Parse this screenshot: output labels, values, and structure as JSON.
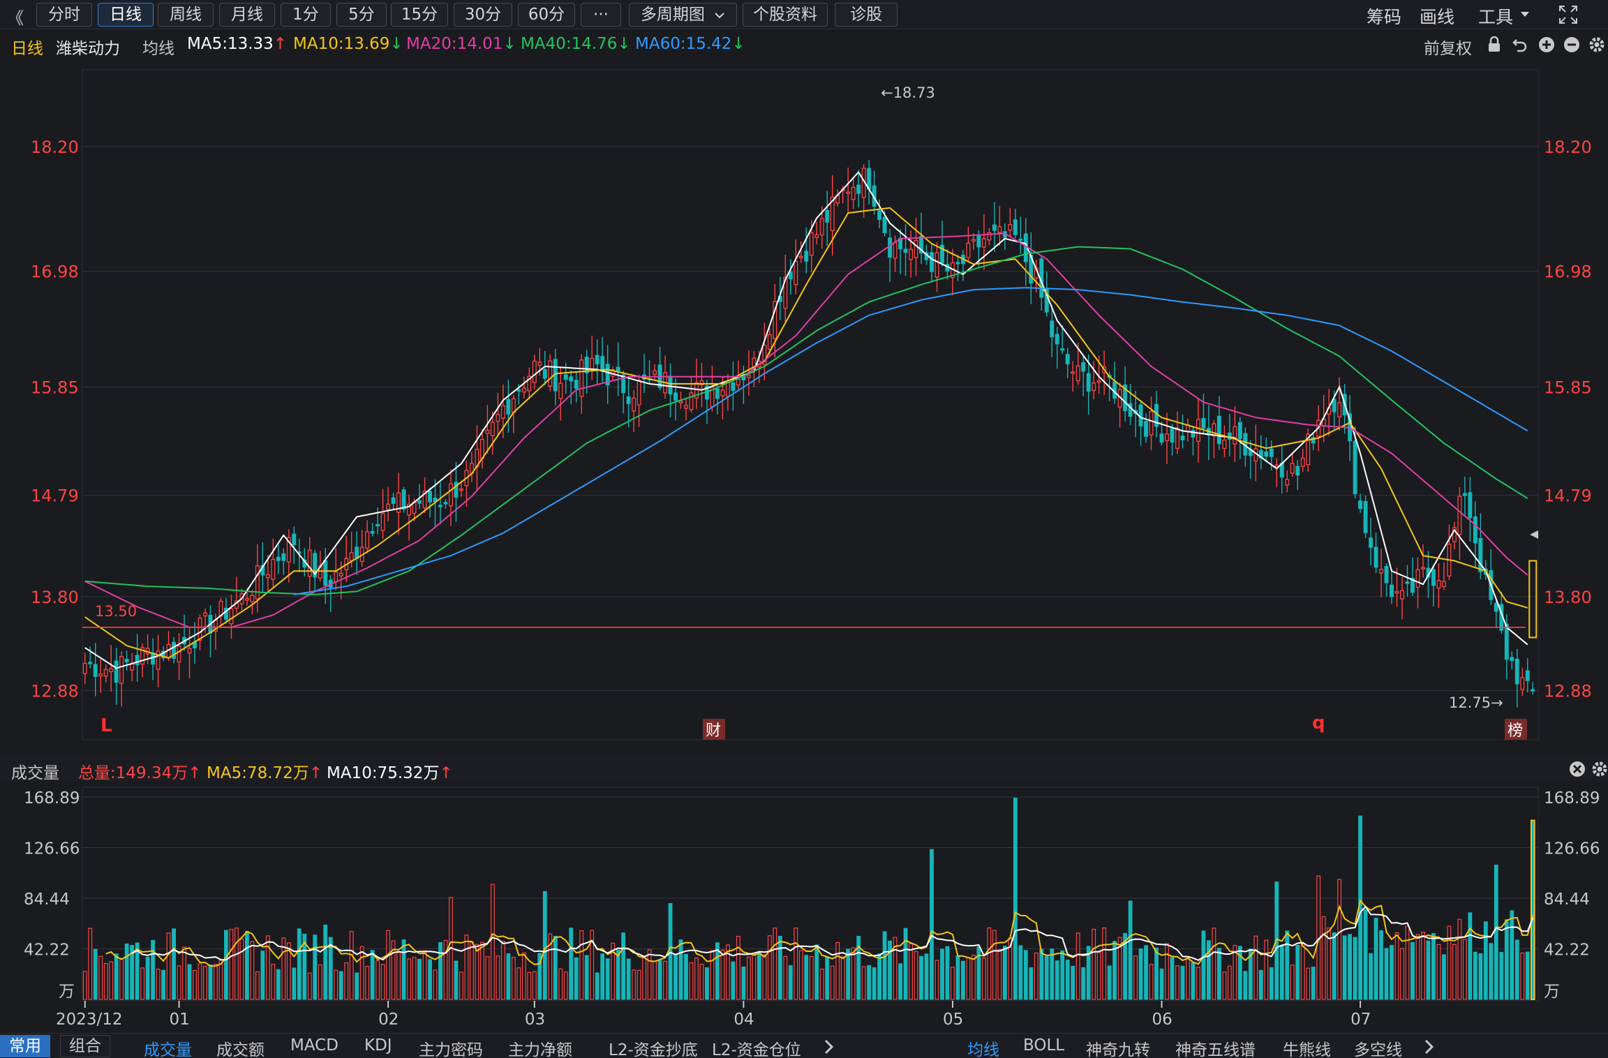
{
  "toolbar": {
    "back_label": "《",
    "periods": [
      "分时",
      "日线",
      "周线",
      "月线",
      "1分",
      "5分",
      "15分",
      "30分",
      "60分",
      "···"
    ],
    "active_period": "日线",
    "multi_label": "多周期图",
    "profile_label": "个股资料",
    "diagnose_label": "诊股",
    "right_items": [
      "筹码",
      "画线",
      "工具"
    ]
  },
  "infobar": {
    "period": "日线",
    "stock_name": "潍柴动力",
    "ma_label": "均线",
    "ma5": "MA5:13.33",
    "ma10": "MA10:13.69",
    "ma20": "MA20:14.01",
    "ma40": "MA40:14.76",
    "ma60": "MA60:15.42",
    "adjust": "前复权"
  },
  "volbar": {
    "title": "成交量",
    "total": "总量:149.34万",
    "ma5": "MA5:78.72万",
    "ma10": "MA10:75.32万"
  },
  "bottombar": {
    "left_tabs": [
      "常用",
      "组合"
    ],
    "indicators": [
      "成交量",
      "成交额",
      "MACD",
      "KDJ",
      "主力密码",
      "主力净额",
      "L2-资金抄底",
      "L2-资金仓位"
    ],
    "overlays": [
      "均线",
      "BOLL",
      "神奇九转",
      "神奇五线谱",
      "牛熊线",
      "多空线"
    ]
  },
  "colors": {
    "up": "#ff4444",
    "down": "#16b5b8",
    "ma5": "#ffffff",
    "ma10": "#f5c518",
    "ma20": "#e23ea8",
    "ma40": "#22c55e",
    "ma60": "#2f9bff",
    "support": "#ff4444"
  },
  "chart_data": [
    {
      "type": "candlestick",
      "title": "潍柴动力 日线",
      "ylim": [
        12.4,
        18.95
      ],
      "y_ticks": [
        "18.20",
        "16.98",
        "15.85",
        "14.79",
        "13.80",
        "12.88"
      ],
      "x_ticks": [
        "2023/12",
        "01",
        "02",
        "03",
        "04",
        "05",
        "06",
        "07"
      ],
      "annotations": {
        "high_label": "←18.73",
        "low_label": "12.75→",
        "support_label": "13.50",
        "support_value": 13.5,
        "markers": [
          "L",
          "财",
          "q",
          "榜"
        ]
      },
      "anchor_closes": [
        [
          0,
          13.15
        ],
        [
          6,
          13.08
        ],
        [
          12,
          13.25
        ],
        [
          18,
          13.3
        ],
        [
          24,
          13.55
        ],
        [
          30,
          13.78
        ],
        [
          36,
          14.15
        ],
        [
          40,
          14.35
        ],
        [
          46,
          13.92
        ],
        [
          50,
          14.1
        ],
        [
          56,
          14.62
        ],
        [
          62,
          14.72
        ],
        [
          68,
          14.75
        ],
        [
          74,
          15.0
        ],
        [
          80,
          15.65
        ],
        [
          86,
          16.05
        ],
        [
          92,
          15.9
        ],
        [
          98,
          16.05
        ],
        [
          104,
          15.82
        ],
        [
          110,
          15.92
        ],
        [
          116,
          15.78
        ],
        [
          122,
          15.88
        ],
        [
          128,
          16.05
        ],
        [
          134,
          16.95
        ],
        [
          140,
          17.35
        ],
        [
          146,
          17.82
        ],
        [
          150,
          17.9
        ],
        [
          154,
          17.25
        ],
        [
          160,
          17.15
        ],
        [
          166,
          16.95
        ],
        [
          172,
          17.3
        ],
        [
          178,
          17.3
        ],
        [
          182,
          16.88
        ],
        [
          186,
          16.2
        ],
        [
          190,
          15.95
        ],
        [
          196,
          15.9
        ],
        [
          202,
          15.52
        ],
        [
          208,
          15.4
        ],
        [
          214,
          15.42
        ],
        [
          220,
          15.35
        ],
        [
          226,
          15.2
        ],
        [
          232,
          15.0
        ],
        [
          236,
          15.55
        ],
        [
          240,
          15.8
        ],
        [
          244,
          14.65
        ],
        [
          248,
          14.0
        ],
        [
          252,
          13.75
        ],
        [
          256,
          14.0
        ],
        [
          260,
          14.05
        ],
        [
          264,
          14.85
        ],
        [
          268,
          13.9
        ],
        [
          272,
          13.25
        ],
        [
          276,
          12.85
        ]
      ],
      "ma_series": [
        {
          "name": "MA5",
          "anchors": [
            [
              0,
              13.3
            ],
            [
              6,
              13.1
            ],
            [
              14,
              13.22
            ],
            [
              22,
              13.45
            ],
            [
              30,
              13.78
            ],
            [
              38,
              14.4
            ],
            [
              44,
              14.02
            ],
            [
              52,
              14.58
            ],
            [
              62,
              14.68
            ],
            [
              72,
              15.1
            ],
            [
              80,
              15.72
            ],
            [
              88,
              16.05
            ],
            [
              98,
              16.02
            ],
            [
              108,
              15.88
            ],
            [
              118,
              15.82
            ],
            [
              128,
              16.0
            ],
            [
              134,
              16.9
            ],
            [
              140,
              17.5
            ],
            [
              148,
              17.95
            ],
            [
              154,
              17.45
            ],
            [
              162,
              17.1
            ],
            [
              168,
              16.95
            ],
            [
              176,
              17.3
            ],
            [
              180,
              17.25
            ],
            [
              186,
              16.5
            ],
            [
              194,
              15.95
            ],
            [
              202,
              15.55
            ],
            [
              210,
              15.42
            ],
            [
              220,
              15.35
            ],
            [
              228,
              15.05
            ],
            [
              236,
              15.45
            ],
            [
              240,
              15.85
            ],
            [
              244,
              15.2
            ],
            [
              250,
              14.05
            ],
            [
              256,
              13.92
            ],
            [
              262,
              14.45
            ],
            [
              268,
              14.05
            ],
            [
              272,
              13.5
            ],
            [
              276,
              13.33
            ]
          ]
        },
        {
          "name": "MA10",
          "anchors": [
            [
              0,
              13.6
            ],
            [
              8,
              13.32
            ],
            [
              16,
              13.2
            ],
            [
              24,
              13.45
            ],
            [
              32,
              13.72
            ],
            [
              40,
              14.05
            ],
            [
              48,
              14.05
            ],
            [
              56,
              14.3
            ],
            [
              64,
              14.6
            ],
            [
              74,
              15.0
            ],
            [
              82,
              15.6
            ],
            [
              90,
              15.98
            ],
            [
              100,
              16.02
            ],
            [
              112,
              15.88
            ],
            [
              122,
              15.88
            ],
            [
              130,
              16.1
            ],
            [
              138,
              16.85
            ],
            [
              146,
              17.55
            ],
            [
              154,
              17.6
            ],
            [
              162,
              17.25
            ],
            [
              170,
              17.05
            ],
            [
              178,
              17.1
            ],
            [
              186,
              16.65
            ],
            [
              196,
              15.95
            ],
            [
              206,
              15.55
            ],
            [
              216,
              15.4
            ],
            [
              226,
              15.25
            ],
            [
              236,
              15.35
            ],
            [
              242,
              15.5
            ],
            [
              248,
              15.05
            ],
            [
              256,
              14.2
            ],
            [
              262,
              14.15
            ],
            [
              268,
              14.05
            ],
            [
              272,
              13.75
            ],
            [
              276,
              13.69
            ]
          ]
        },
        {
          "name": "MA20",
          "anchors": [
            [
              0,
              13.95
            ],
            [
              10,
              13.7
            ],
            [
              20,
              13.5
            ],
            [
              28,
              13.5
            ],
            [
              36,
              13.62
            ],
            [
              44,
              13.85
            ],
            [
              54,
              14.08
            ],
            [
              64,
              14.35
            ],
            [
              74,
              14.78
            ],
            [
              84,
              15.35
            ],
            [
              94,
              15.82
            ],
            [
              104,
              15.95
            ],
            [
              116,
              15.95
            ],
            [
              126,
              15.95
            ],
            [
              136,
              16.35
            ],
            [
              146,
              16.95
            ],
            [
              156,
              17.3
            ],
            [
              166,
              17.32
            ],
            [
              176,
              17.35
            ],
            [
              184,
              17.1
            ],
            [
              194,
              16.55
            ],
            [
              204,
              16.05
            ],
            [
              214,
              15.7
            ],
            [
              224,
              15.55
            ],
            [
              234,
              15.48
            ],
            [
              242,
              15.45
            ],
            [
              250,
              15.2
            ],
            [
              258,
              14.85
            ],
            [
              266,
              14.5
            ],
            [
              272,
              14.18
            ],
            [
              276,
              14.01
            ]
          ]
        },
        {
          "name": "MA40",
          "anchors": [
            [
              0,
              13.95
            ],
            [
              12,
              13.9
            ],
            [
              24,
              13.88
            ],
            [
              34,
              13.84
            ],
            [
              44,
              13.82
            ],
            [
              52,
              13.85
            ],
            [
              62,
              14.05
            ],
            [
              72,
              14.4
            ],
            [
              84,
              14.85
            ],
            [
              96,
              15.3
            ],
            [
              108,
              15.62
            ],
            [
              120,
              15.82
            ],
            [
              130,
              16.05
            ],
            [
              140,
              16.4
            ],
            [
              150,
              16.68
            ],
            [
              160,
              16.85
            ],
            [
              170,
              17.0
            ],
            [
              180,
              17.15
            ],
            [
              190,
              17.22
            ],
            [
              200,
              17.2
            ],
            [
              210,
              17.0
            ],
            [
              220,
              16.72
            ],
            [
              230,
              16.42
            ],
            [
              240,
              16.15
            ],
            [
              250,
              15.72
            ],
            [
              260,
              15.3
            ],
            [
              270,
              14.95
            ],
            [
              276,
              14.76
            ]
          ]
        },
        {
          "name": "MA60",
          "anchors": [
            [
              40,
              13.82
            ],
            [
              50,
              13.9
            ],
            [
              60,
              14.05
            ],
            [
              70,
              14.2
            ],
            [
              80,
              14.42
            ],
            [
              90,
              14.72
            ],
            [
              100,
              15.02
            ],
            [
              110,
              15.32
            ],
            [
              120,
              15.65
            ],
            [
              130,
              15.98
            ],
            [
              140,
              16.28
            ],
            [
              150,
              16.55
            ],
            [
              160,
              16.7
            ],
            [
              170,
              16.8
            ],
            [
              180,
              16.82
            ],
            [
              190,
              16.8
            ],
            [
              200,
              16.75
            ],
            [
              210,
              16.68
            ],
            [
              220,
              16.62
            ],
            [
              230,
              16.55
            ],
            [
              240,
              16.45
            ],
            [
              250,
              16.2
            ],
            [
              260,
              15.9
            ],
            [
              270,
              15.6
            ],
            [
              276,
              15.42
            ]
          ]
        }
      ]
    },
    {
      "type": "bar",
      "title": "成交量",
      "unit": "万",
      "ylim": [
        0,
        168.89
      ],
      "y_ticks": [
        "168.89",
        "126.66",
        "84.44",
        "42.22"
      ],
      "spikes": [
        [
          46,
          62
        ],
        [
          70,
          85
        ],
        [
          78,
          96
        ],
        [
          88,
          90
        ],
        [
          112,
          80
        ],
        [
          162,
          125
        ],
        [
          178,
          168
        ],
        [
          200,
          82
        ],
        [
          228,
          98
        ],
        [
          236,
          103
        ],
        [
          240,
          100
        ],
        [
          244,
          153
        ],
        [
          270,
          112
        ],
        [
          277,
          149.34
        ]
      ],
      "series": [
        {
          "name": "MA5",
          "last": 78.72
        },
        {
          "name": "MA10",
          "last": 75.32
        }
      ]
    }
  ]
}
